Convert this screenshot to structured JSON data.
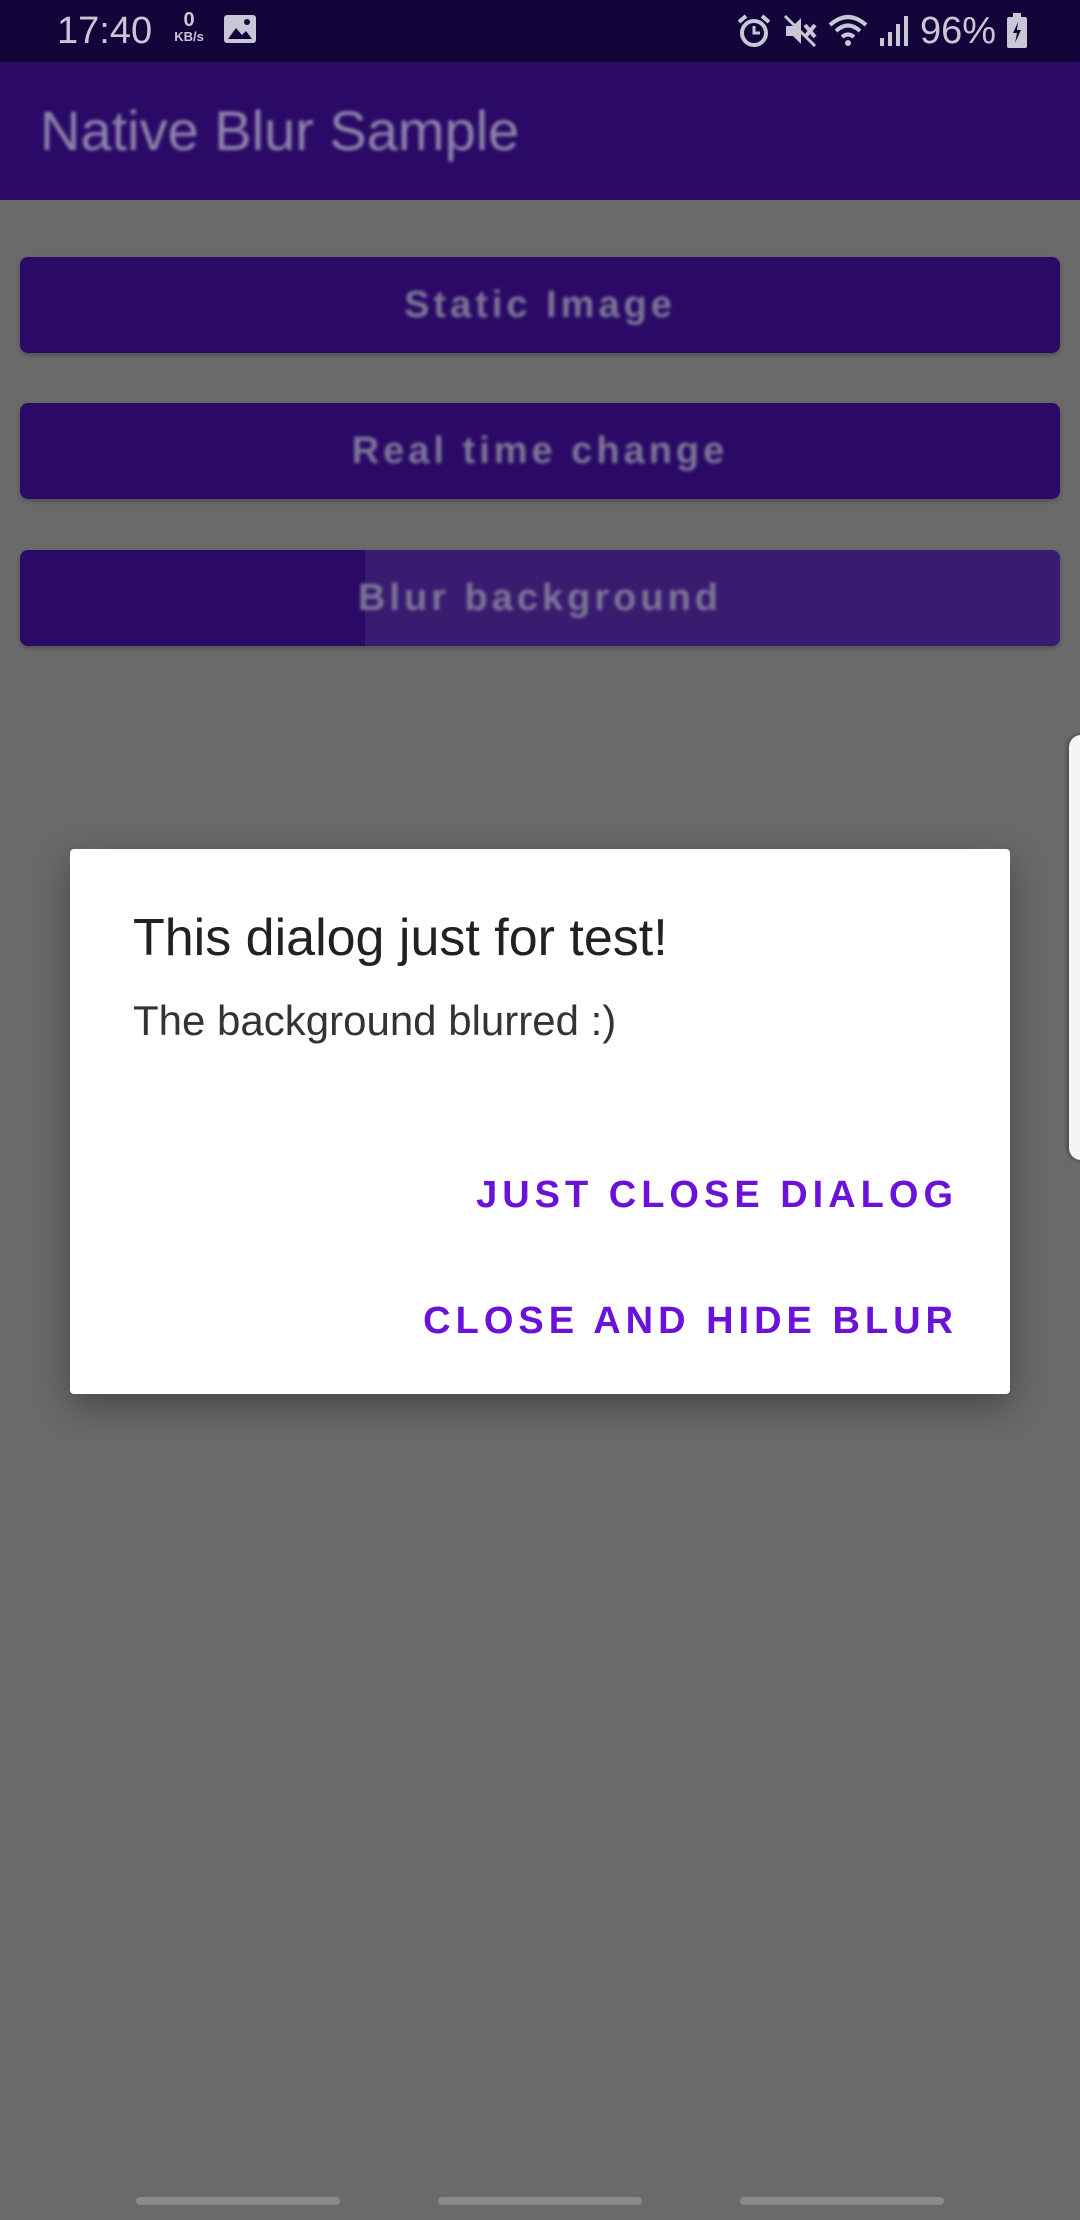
{
  "status_bar": {
    "time": "17:40",
    "net_speed_value": "0",
    "net_speed_unit": "KB/s",
    "battery": "96%",
    "icons": [
      "image-icon",
      "alarm-icon",
      "mute-icon",
      "wifi-icon",
      "signal-icon",
      "battery-icon"
    ]
  },
  "app_bar": {
    "title": "Native Blur Sample"
  },
  "buttons": {
    "static_image": "Static Image",
    "real_time_change": "Real time change",
    "blur_background": "Blur background"
  },
  "dialog": {
    "title": "This dialog just for test!",
    "message": "The background blurred :)",
    "action_close": "JUST CLOSE DIALOG",
    "action_close_hide": "CLOSE AND HIDE BLUR"
  },
  "colors": {
    "primary": "#2a0a66",
    "accent": "#6a12d8",
    "scrim": "#6a6a6a"
  }
}
